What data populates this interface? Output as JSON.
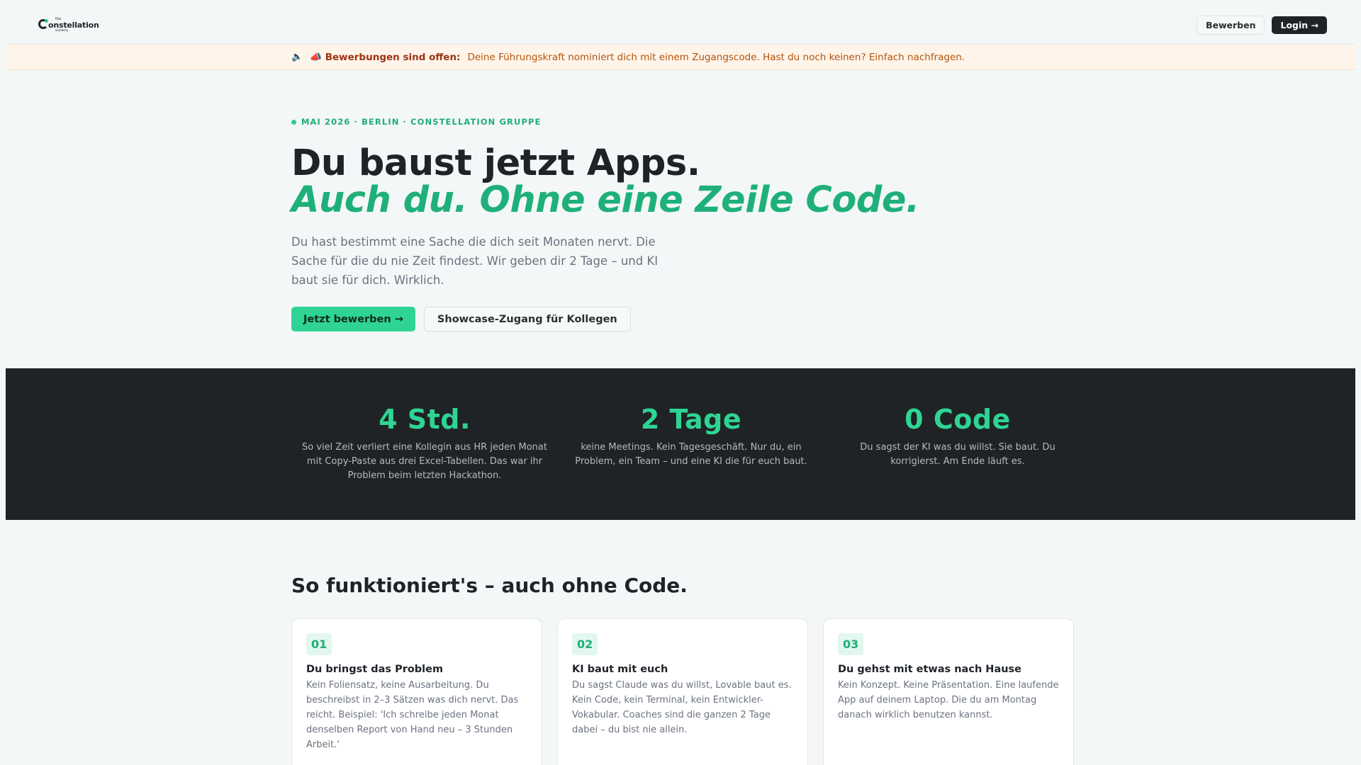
{
  "nav": {
    "logo_the": "the",
    "logo_name": "onstellation",
    "logo_sub": "academy",
    "apply_label": "Bewerben",
    "login_label": "Login →"
  },
  "banner": {
    "lead": "📣 Bewerbungen sind offen:",
    "message": "Deine Führungskraft nominiert dich mit einem Zugangscode. Hast du noch keinen? Einfach nachfragen."
  },
  "hero": {
    "eyebrow": "MAI 2026 · BERLIN · CONSTELLATION GRUPPE",
    "headline": "Du baust jetzt Apps.",
    "headline_accent": "Auch du. Ohne eine Zeile Code.",
    "lede": "Du hast bestimmt eine Sache die dich seit Monaten nervt. Die Sache für die du nie Zeit findest. Wir geben dir 2 Tage – und KI baut sie für dich. Wirklich.",
    "cta_primary": "Jetzt bewerben →",
    "cta_secondary": "Showcase-Zugang für Kollegen"
  },
  "stats": [
    {
      "value": "4 Std.",
      "desc": "So viel Zeit verliert eine Kollegin aus HR jeden Monat mit Copy-Paste aus drei Excel-Tabellen. Das war ihr Problem beim letzten Hackathon."
    },
    {
      "value": "2 Tage",
      "desc": "keine Meetings. Kein Tagesgeschäft. Nur du, ein Problem, ein Team – und eine KI die für euch baut."
    },
    {
      "value": "0 Code",
      "desc": "Du sagst der KI was du willst. Sie baut. Du korrigierst. Am Ende läuft es."
    }
  ],
  "how": {
    "title": "So funktioniert's – auch ohne Code.",
    "cards": [
      {
        "num": "01",
        "title": "Du bringst das Problem",
        "body": "Kein Foliensatz, keine Ausarbeitung. Du beschreibst in 2–3 Sätzen was dich nervt. Das reicht. Beispiel: 'Ich schreibe jeden Monat denselben Report von Hand neu – 3 Stunden Arbeit.'"
      },
      {
        "num": "02",
        "title": "KI baut mit euch",
        "body": "Du sagst Claude was du willst, Lovable baut es. Kein Code, kein Terminal, kein Entwickler-Vokabular. Coaches sind die ganzen 2 Tage dabei – du bist nie allein."
      },
      {
        "num": "03",
        "title": "Du gehst mit etwas nach Hause",
        "body": "Kein Konzept. Keine Präsentation. Eine laufende App auf deinem Laptop. Die du am Montag danach wirklich benutzen kannst."
      }
    ]
  },
  "colors": {
    "accent": "#2fd494",
    "accent_text": "#1fb07a",
    "dark": "#1f2326",
    "banner_bg": "#fef4ea"
  }
}
